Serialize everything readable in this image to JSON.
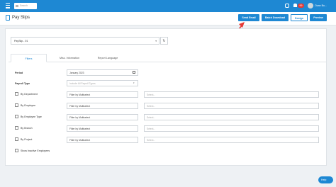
{
  "topbar": {
    "search_placeholder": "Search",
    "notification_count": "99",
    "username": "Ozan Bu..."
  },
  "header": {
    "title": "Pay Slips",
    "buttons": {
      "send_email": "Send Email",
      "batch_download": "Batch Download",
      "design": "Design",
      "preview": "Preview"
    }
  },
  "payslip": {
    "selected": "PaySlip - 01"
  },
  "tabs": [
    {
      "label": "Filters",
      "active": true
    },
    {
      "label": "Misc. Information",
      "active": false
    },
    {
      "label": "Report Language",
      "active": false
    }
  ],
  "filters": {
    "period_label": "Period",
    "period_value": "January 2023",
    "payroll_type_label": "Payroll Type",
    "payroll_type_placeholder": "Include All Payroll Types",
    "multiselect_placeholder": "Filter by Multiselect",
    "text_placeholder": "Select...",
    "rows": [
      {
        "label": "By Department"
      },
      {
        "label": "By Employee"
      },
      {
        "label": "By Employee Type"
      },
      {
        "label": "By Branch"
      },
      {
        "label": "By Project"
      }
    ],
    "show_inactive_label": "Show Inactive Employees"
  },
  "help": {
    "label": "Help"
  },
  "colors": {
    "primary": "#1e88d3",
    "annotation_arrow": "#e53935",
    "badge": "#e53935"
  }
}
